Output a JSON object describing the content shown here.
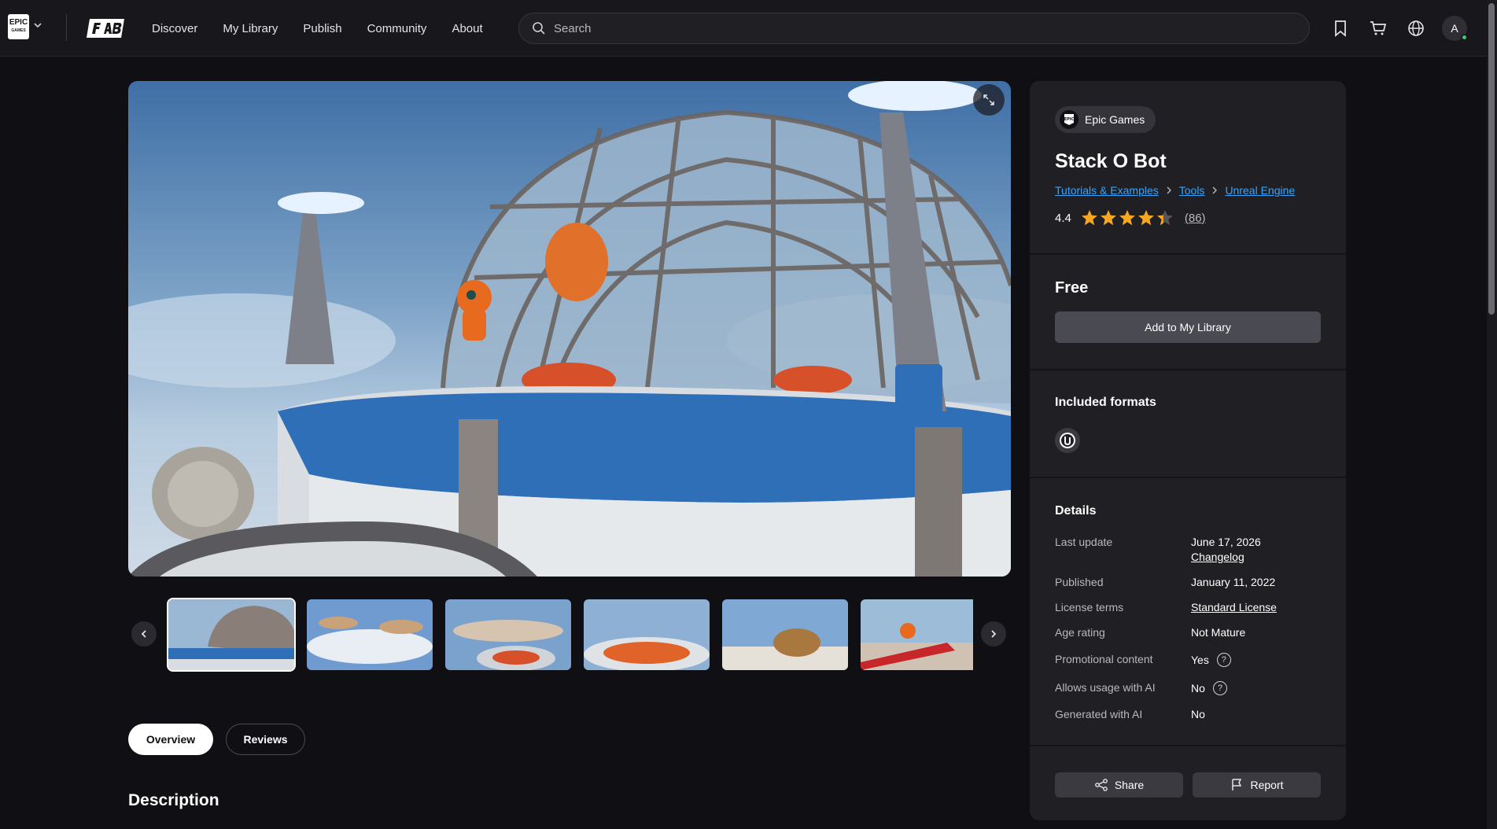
{
  "topbar": {
    "brand": "EPIC",
    "brand_sub": "GAMES",
    "nav": [
      "Discover",
      "My Library",
      "Publish",
      "Community",
      "About"
    ],
    "search_placeholder": "Search",
    "avatar_letter": "A"
  },
  "gallery": {
    "thumb_count": 6,
    "active_index": 0
  },
  "tabs": {
    "overview": "Overview",
    "reviews": "Reviews"
  },
  "description_heading": "Description",
  "product": {
    "seller": "Epic Games",
    "title": "Stack O Bot",
    "breadcrumb": [
      "Tutorials & Examples",
      "Tools",
      "Unreal Engine"
    ],
    "rating": "4.4",
    "rating_value": 4.4,
    "rating_count": "(86)",
    "price": "Free",
    "add_button": "Add to My Library",
    "formats_heading": "Included formats",
    "details_heading": "Details",
    "details": {
      "last_update_label": "Last update",
      "last_update_value": "June 17, 2026",
      "changelog": "Changelog",
      "published_label": "Published",
      "published_value": "January 11, 2022",
      "license_label": "License terms",
      "license_value": "Standard License",
      "age_label": "Age rating",
      "age_value": "Not Mature",
      "promo_label": "Promotional content",
      "promo_value": "Yes",
      "ai_usage_label": "Allows usage with AI",
      "ai_usage_value": "No",
      "generated_label": "Generated with AI",
      "generated_value": "No"
    },
    "share": "Share",
    "report": "Report"
  },
  "colors": {
    "background": "#101014",
    "panel": "#202024",
    "link": "#35a4ff",
    "star": "#f5a623",
    "online": "#35d06a"
  }
}
